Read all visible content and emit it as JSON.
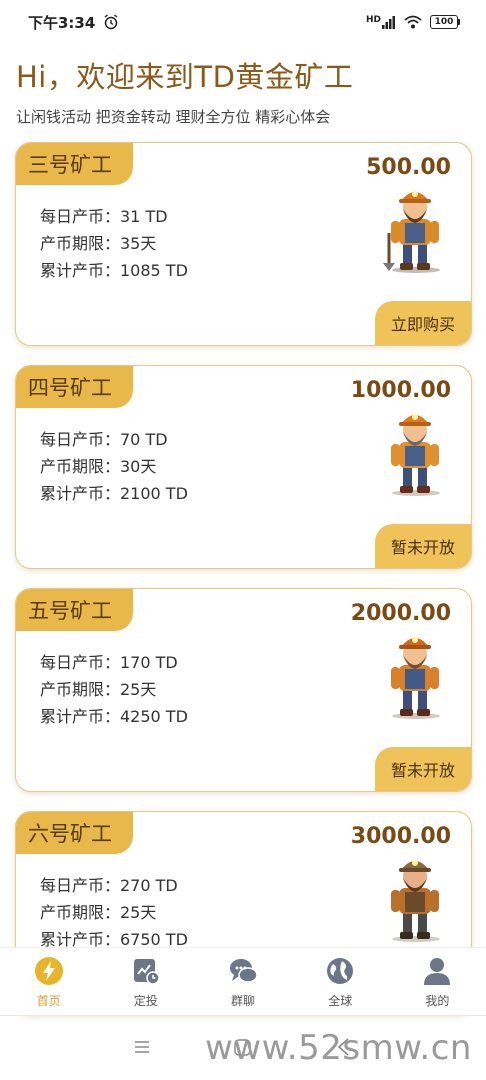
{
  "status_bar": {
    "time": "下午3:34",
    "hd_label": "HD",
    "battery": "100"
  },
  "header": {
    "title": "Hi，欢迎来到TD黄金矿工",
    "subtitle": "让闲钱活动 把资金转动 理财全方位 精彩心体会"
  },
  "cards": [
    {
      "name": "三号矿工",
      "price": "500.00",
      "daily": "每日产币：31 TD",
      "period": "产币期限：35天",
      "total": "累计产币：1085 TD",
      "action": "立即购买"
    },
    {
      "name": "四号矿工",
      "price": "1000.00",
      "daily": "每日产币：70 TD",
      "period": "产币期限：30天",
      "total": "累计产币：2100 TD",
      "action": "暂未开放"
    },
    {
      "name": "五号矿工",
      "price": "2000.00",
      "daily": "每日产币：170 TD",
      "period": "产币期限：25天",
      "total": "累计产币：4250 TD",
      "action": "暂未开放"
    },
    {
      "name": "六号矿工",
      "price": "3000.00",
      "daily": "每日产币：270 TD",
      "period": "产币期限：25天",
      "total": "累计产币：6750 TD",
      "action": ""
    }
  ],
  "bottom_nav": [
    {
      "label": "首页",
      "icon": "lightning-icon",
      "active": true
    },
    {
      "label": "定投",
      "icon": "chart-clock-icon",
      "active": false
    },
    {
      "label": "群聊",
      "icon": "chat-bubbles-icon",
      "active": false
    },
    {
      "label": "全球",
      "icon": "globe-icon",
      "active": false
    },
    {
      "label": "我的",
      "icon": "user-icon",
      "active": false
    }
  ],
  "colors": {
    "accent": "#e8b84a",
    "title": "#8b5a1a",
    "nav_active": "#d9a02c",
    "nav_inactive": "#6b7689"
  },
  "watermark": "www.52smw.cn"
}
